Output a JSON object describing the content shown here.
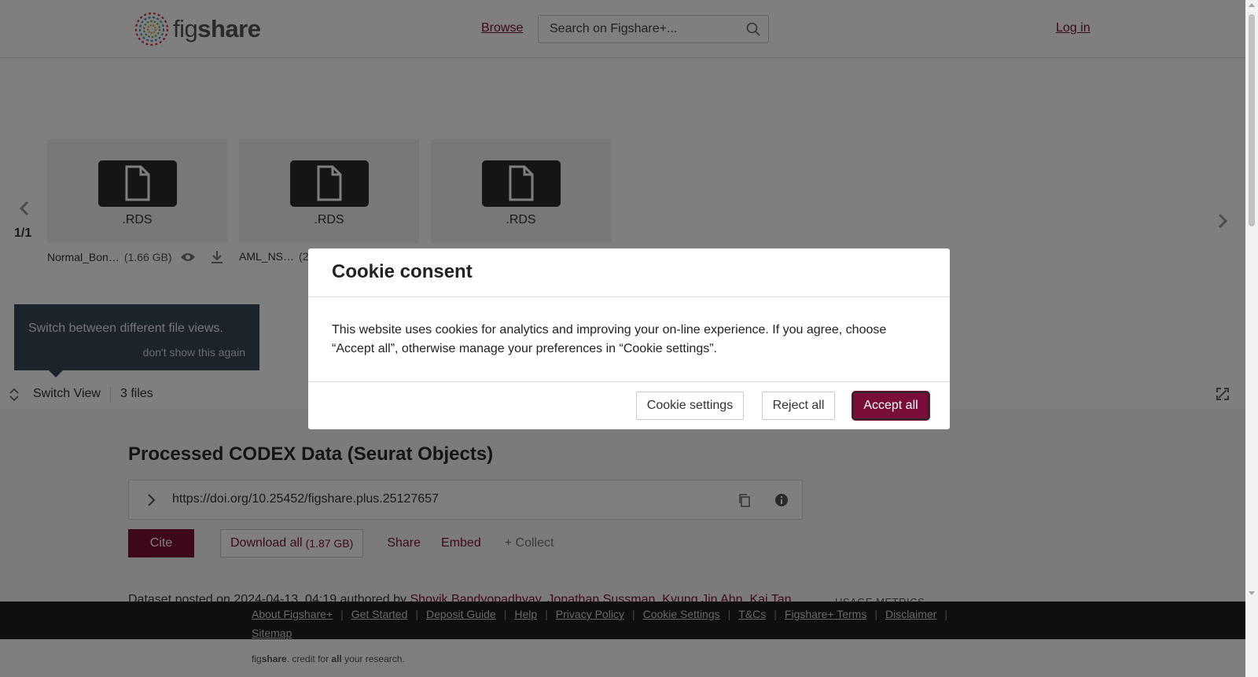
{
  "header": {
    "logo_text_light": "fig",
    "logo_text_bold": "share",
    "browse_label": "Browse",
    "search_placeholder": "Search on Figshare+...",
    "login_label": "Log in"
  },
  "carousel": {
    "page_indicator": "1/1",
    "files": [
      {
        "ext": ".RDS",
        "name": "Normal_Bon…",
        "size": "(1.66 GB)"
      },
      {
        "ext": ".RDS",
        "name": "AML_NS…",
        "size": "(2"
      },
      {
        "ext": ".RDS",
        "name": "",
        "size": ""
      }
    ]
  },
  "tooltip": {
    "text": "Switch between different file views.",
    "dismiss": "don't show this again"
  },
  "switch_bar": {
    "label": "Switch View",
    "files_count": "3 files"
  },
  "item": {
    "title": "Processed CODEX Data (Seurat Objects)",
    "doi": "https://doi.org/10.25452/figshare.plus.25127657",
    "cite_label": "Cite",
    "download_label": "Download all",
    "download_size": "(1.87 GB)",
    "share_label": "Share",
    "embed_label": "Embed",
    "collect_label": "+ Collect",
    "posted_prefix": "Dataset posted on 2024-04-13, 04:19 authored by ",
    "authors": "Shovik Bandyopadhyay, Jonathan Sussman, Kyung Jin Ahn, Kai Tan",
    "usage_label": "USAGE METRICS"
  },
  "footer": {
    "links": [
      "About Figshare+",
      "Get Started",
      "Deposit Guide",
      "Help",
      "Privacy Policy",
      "Cookie Settings",
      "T&Cs",
      "Figshare+ Terms",
      "Disclaimer",
      "Sitemap"
    ],
    "tagline_fig": "fig",
    "tagline_share": "share",
    "tagline_mid": ". credit for ",
    "tagline_all": "all",
    "tagline_end": " your research."
  },
  "cookie_modal": {
    "title": "Cookie consent",
    "body": "This website uses cookies for analytics and improving your on-line experience. If you agree, choose “Accept all”, otherwise manage your preferences in “Cookie settings”.",
    "settings_label": "Cookie settings",
    "reject_label": "Reject all",
    "accept_label": "Accept all"
  },
  "colors": {
    "brand": "#7a0e38",
    "footer_bg": "#1f1f1f",
    "tooltip_bg": "#3a4756"
  }
}
